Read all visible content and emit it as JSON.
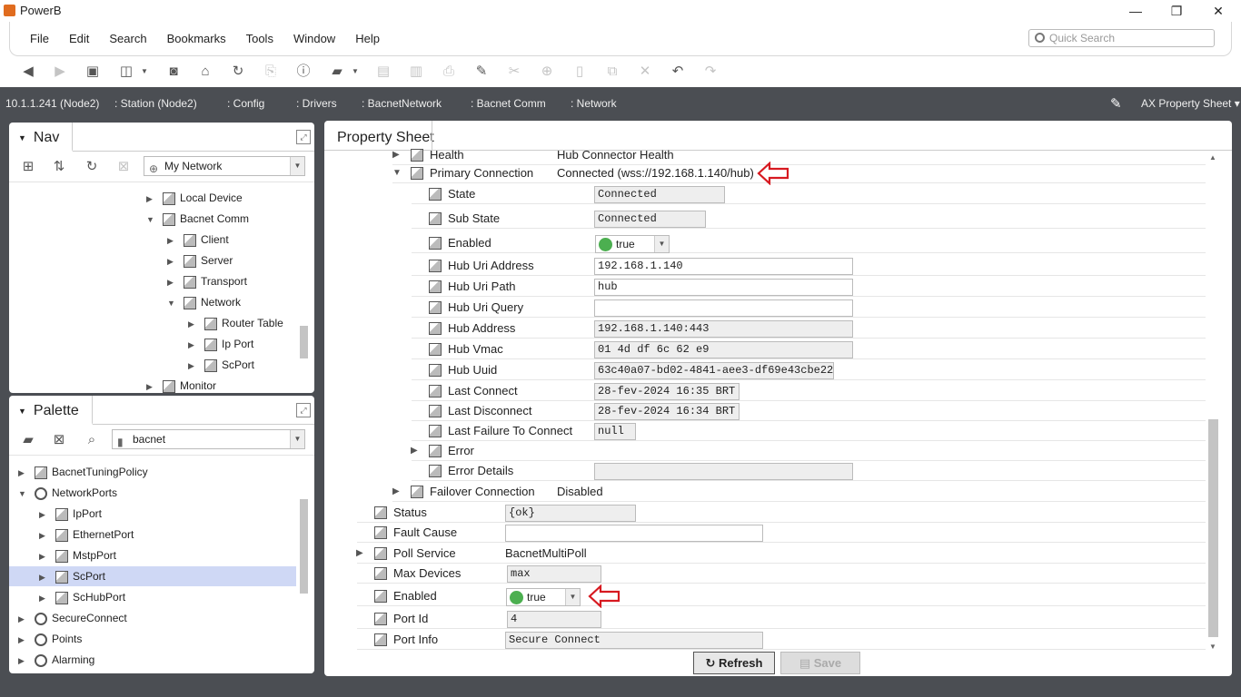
{
  "window": {
    "title": "PowerB",
    "minimize": "—",
    "maximize": "❐",
    "close": "✕"
  },
  "menu": [
    "File",
    "Edit",
    "Search",
    "Bookmarks",
    "Tools",
    "Window",
    "Help"
  ],
  "quick_search": {
    "placeholder": "Quick Search"
  },
  "breadcrumbs": [
    "10.1.1.241 (Node2)",
    "Station (Node2)",
    "Config",
    "Drivers",
    "BacnetNetwork",
    "Bacnet Comm",
    "Network"
  ],
  "view_selector": "AX Property Sheet",
  "nav": {
    "title": "Nav",
    "combo": "My Network",
    "tree": [
      {
        "label": "Local Device",
        "indent": 1,
        "exp": "▶"
      },
      {
        "label": "Bacnet Comm",
        "indent": 1,
        "exp": "▼"
      },
      {
        "label": "Client",
        "indent": 2,
        "exp": "▶"
      },
      {
        "label": "Server",
        "indent": 2,
        "exp": "▶"
      },
      {
        "label": "Transport",
        "indent": 2,
        "exp": "▶"
      },
      {
        "label": "Network",
        "indent": 2,
        "exp": "▼"
      },
      {
        "label": "Router Table",
        "indent": 3,
        "exp": "▶"
      },
      {
        "label": "Ip Port",
        "indent": 3,
        "exp": "▶"
      },
      {
        "label": "ScPort",
        "indent": 3,
        "exp": "▶"
      },
      {
        "label": "Monitor",
        "indent": 1,
        "exp": "▶"
      }
    ]
  },
  "palette": {
    "title": "Palette",
    "combo": "bacnet",
    "tree": [
      {
        "label": "BacnetTuningPolicy",
        "indent": 0,
        "exp": "▶"
      },
      {
        "label": "NetworkPorts",
        "indent": 0,
        "exp": "▼"
      },
      {
        "label": "IpPort",
        "indent": 1,
        "exp": "▶"
      },
      {
        "label": "EthernetPort",
        "indent": 1,
        "exp": "▶"
      },
      {
        "label": "MstpPort",
        "indent": 1,
        "exp": "▶"
      },
      {
        "label": "ScPort",
        "indent": 1,
        "exp": "▶",
        "selected": true
      },
      {
        "label": "ScHubPort",
        "indent": 1,
        "exp": "▶"
      },
      {
        "label": "SecureConnect",
        "indent": 0,
        "exp": "▶"
      },
      {
        "label": "Points",
        "indent": 0,
        "exp": "▶"
      },
      {
        "label": "Alarming",
        "indent": 0,
        "exp": "▶"
      }
    ]
  },
  "property_sheet": {
    "tab": "Property Sheet",
    "health": {
      "label": "Health",
      "value": "Hub Connector Health"
    },
    "primary_connection": {
      "label": "Primary Connection",
      "value": "Connected (wss://192.168.1.140/hub)"
    },
    "props": {
      "state": {
        "label": "State",
        "value": "Connected"
      },
      "sub_state": {
        "label": "Sub State",
        "value": "Connected"
      },
      "enabled": {
        "label": "Enabled",
        "value": "true"
      },
      "hub_uri_address": {
        "label": "Hub Uri Address",
        "value": "192.168.1.140"
      },
      "hub_uri_path": {
        "label": "Hub Uri Path",
        "value": "hub"
      },
      "hub_uri_query": {
        "label": "Hub Uri Query",
        "value": ""
      },
      "hub_address": {
        "label": "Hub Address",
        "value": "192.168.1.140:443"
      },
      "hub_vmac": {
        "label": "Hub Vmac",
        "value": "01 4d df 6c 62 e9"
      },
      "hub_uuid": {
        "label": "Hub Uuid",
        "value": "63c40a07-bd02-4841-aee3-df69e43cbe22"
      },
      "last_connect": {
        "label": "Last Connect",
        "value": "28-fev-2024 16:35 BRT"
      },
      "last_disconnect": {
        "label": "Last Disconnect",
        "value": "28-fev-2024 16:34 BRT"
      },
      "last_failure": {
        "label": "Last Failure To Connect",
        "value": "null"
      },
      "error": {
        "label": "Error"
      },
      "error_details": {
        "label": "Error Details",
        "value": ""
      }
    },
    "failover": {
      "label": "Failover Connection",
      "value": "Disabled"
    },
    "port": {
      "status": {
        "label": "Status",
        "value": "{ok}"
      },
      "fault_cause": {
        "label": "Fault Cause",
        "value": ""
      },
      "poll_service": {
        "label": "Poll Service",
        "value": "BacnetMultiPoll"
      },
      "max_devices": {
        "label": "Max Devices",
        "value": "max"
      },
      "enabled": {
        "label": "Enabled",
        "value": "true"
      },
      "port_id": {
        "label": "Port Id",
        "value": "4"
      },
      "port_info": {
        "label": "Port Info",
        "value": "Secure Connect"
      }
    },
    "buttons": {
      "refresh": "Refresh",
      "save": "Save"
    }
  },
  "colors": {
    "chrome_dark": "#4b4e53",
    "enabled_dot": "#4caf50",
    "annotation_arrow": "#d71920",
    "selection": "#cfd8f5"
  }
}
